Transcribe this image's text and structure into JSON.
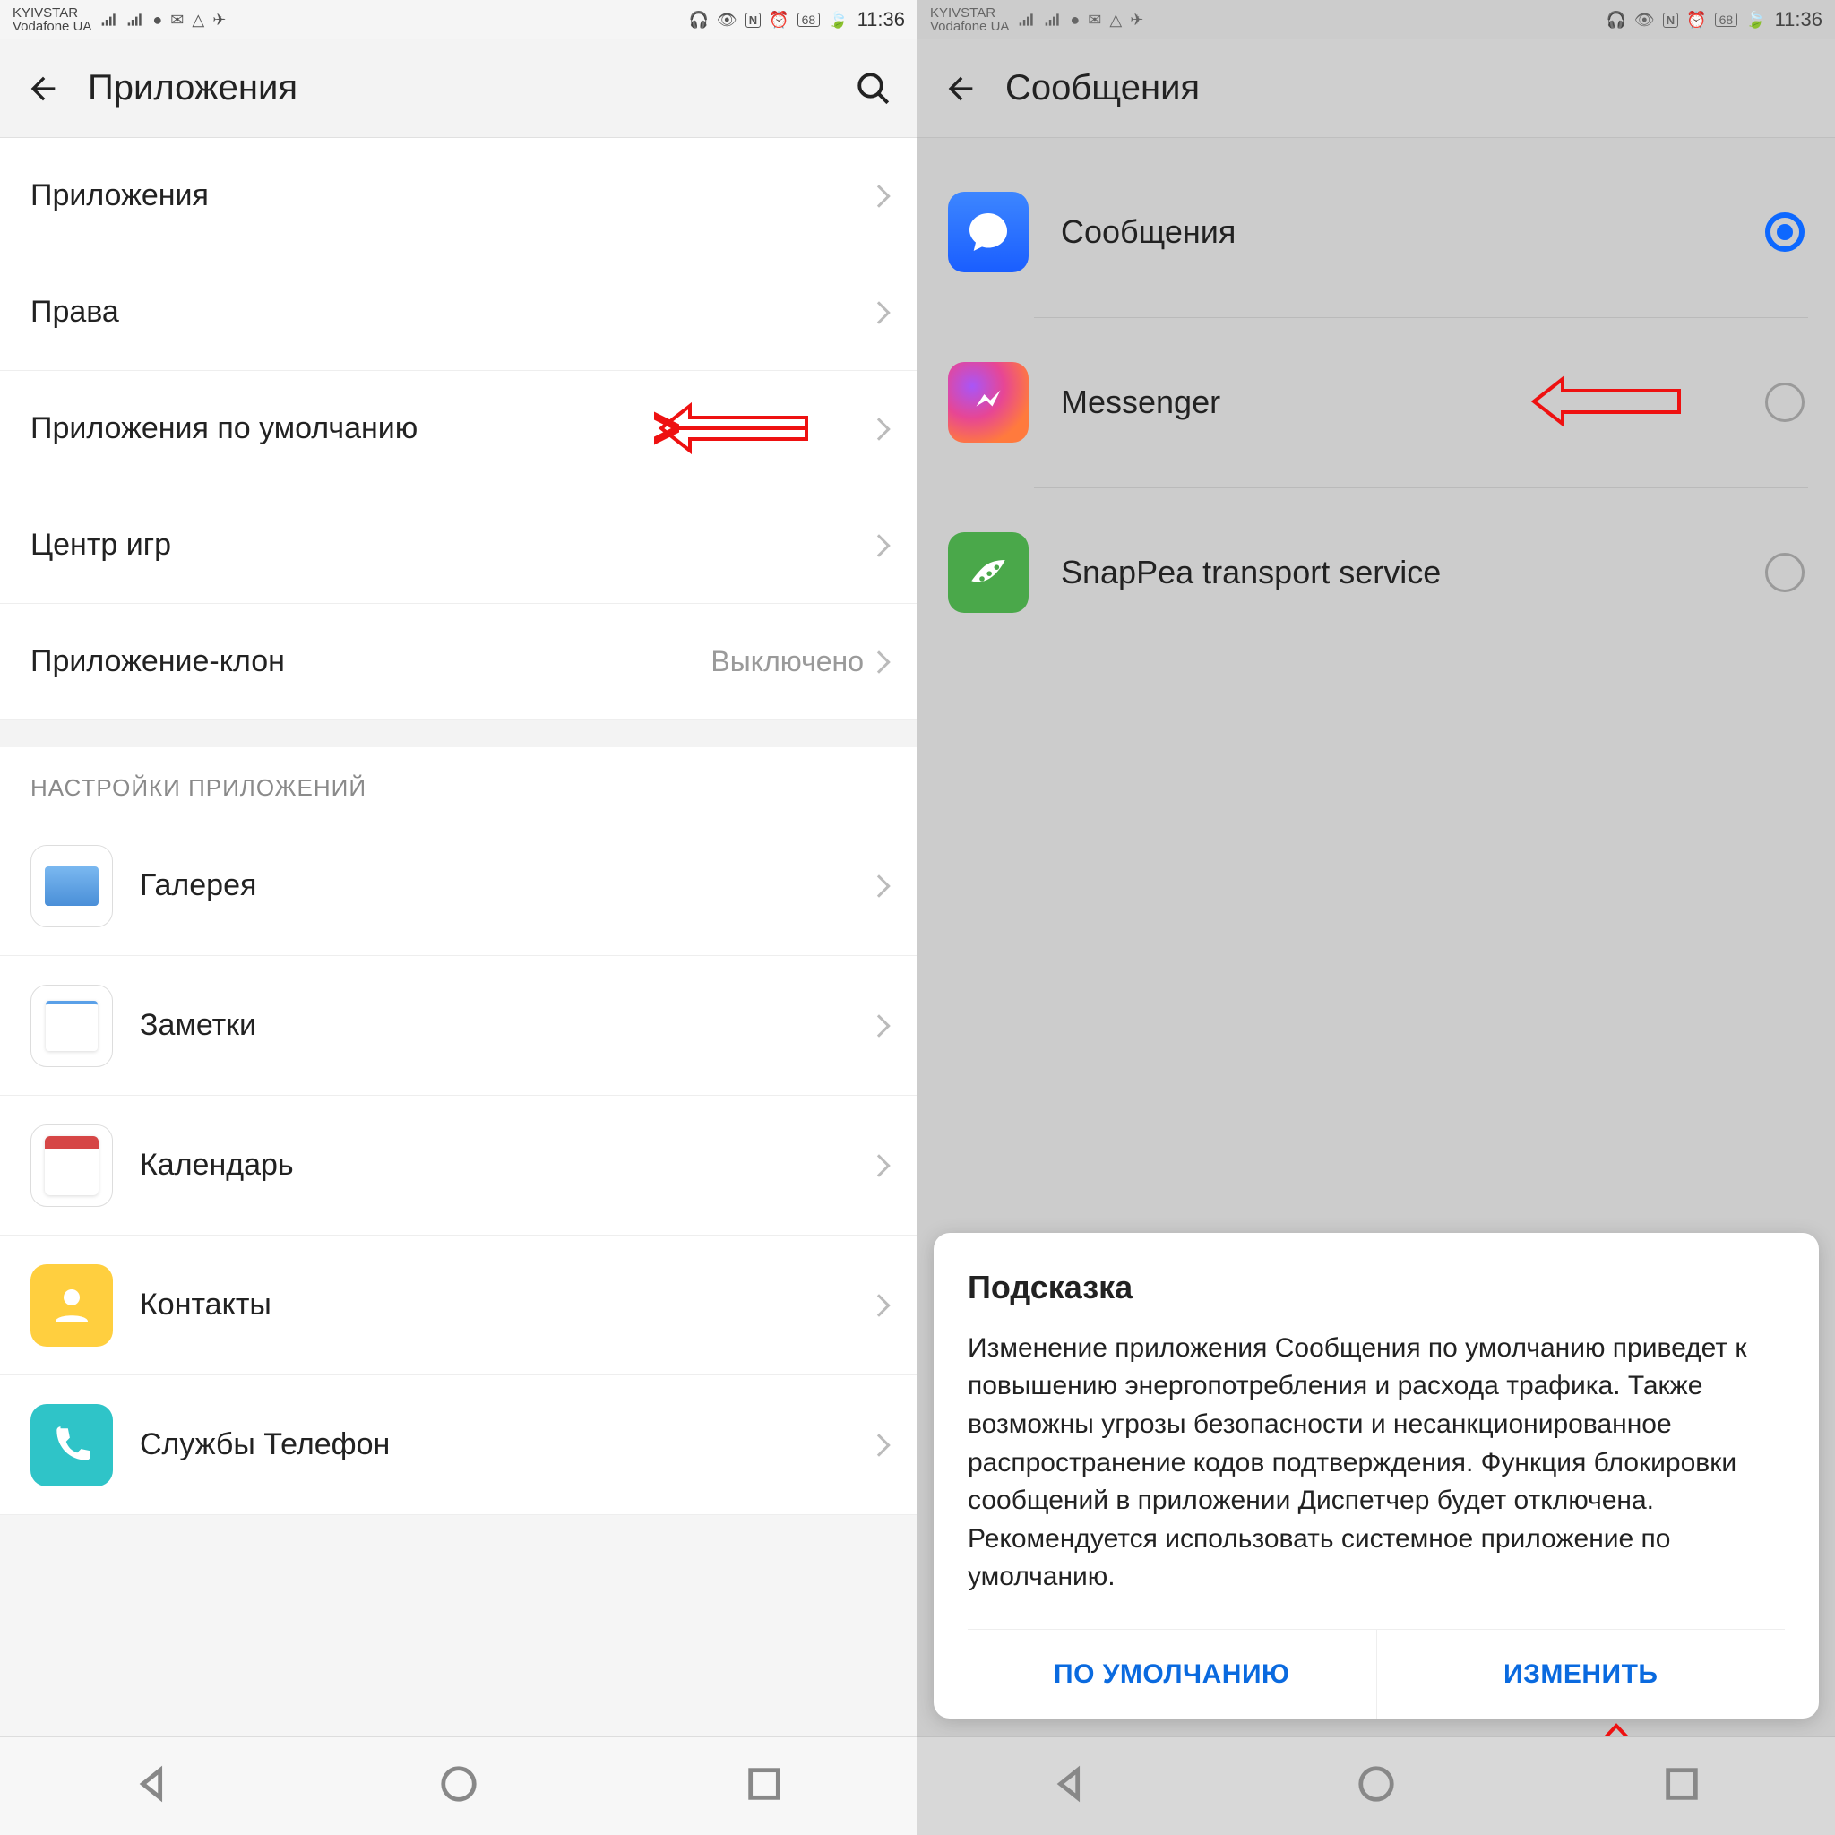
{
  "statusbar": {
    "carrier1": "KYIVSTAR",
    "carrier2": "Vodafone UA",
    "battery": "68",
    "time": "11:36"
  },
  "left": {
    "title": "Приложения",
    "rows": [
      {
        "label": "Приложения"
      },
      {
        "label": "Права"
      },
      {
        "label": "Приложения по умолчанию"
      },
      {
        "label": "Центр игр"
      },
      {
        "label": "Приложение-клон",
        "value": "Выключено"
      }
    ],
    "section_title": "НАСТРОЙКИ ПРИЛОЖЕНИЙ",
    "apps": [
      {
        "label": "Галерея"
      },
      {
        "label": "Заметки"
      },
      {
        "label": "Календарь"
      },
      {
        "label": "Контакты"
      },
      {
        "label": "Службы Телефон"
      }
    ]
  },
  "right": {
    "title": "Сообщения",
    "apps": [
      {
        "label": "Сообщения",
        "selected": true
      },
      {
        "label": "Messenger",
        "selected": false
      },
      {
        "label": "SnapPea transport service",
        "selected": false
      }
    ],
    "dialog": {
      "title": "Подсказка",
      "body": "Изменение приложения Сообщения по умолчанию приведет к повышению энергопотребления и расхода трафика. Также возможны угрозы безопасности и несанкционированное распространение кодов подтверждения. Функция блокировки сообщений в приложении Диспетчер будет отключена. Рекомендуется использовать системное приложение по умолчанию.",
      "btn_default": "ПО УМОЛЧАНИЮ",
      "btn_change": "ИЗМЕНИТЬ"
    }
  }
}
